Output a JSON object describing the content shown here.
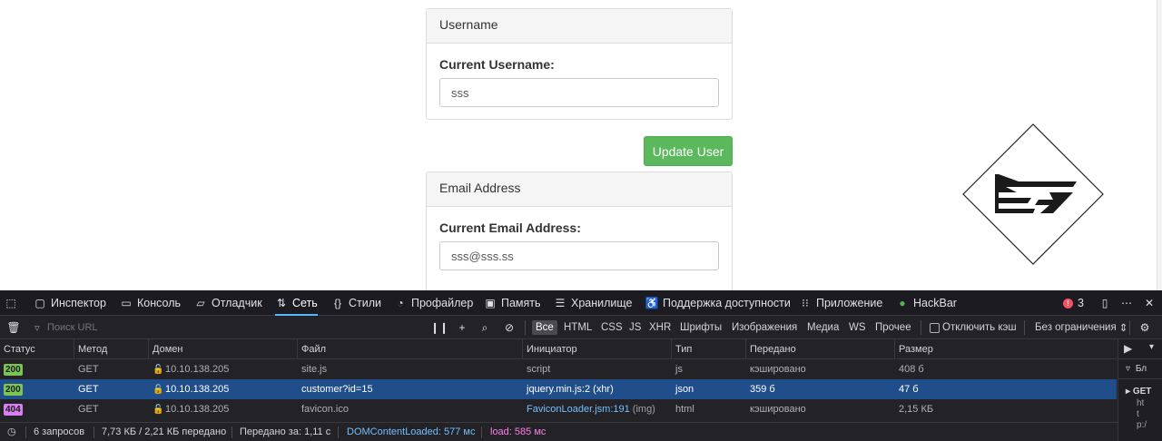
{
  "page": {
    "username_panel": {
      "heading": "Username",
      "label": "Current Username:",
      "value": "sss"
    },
    "update_button": "Update User",
    "email_panel": {
      "heading": "Email Address",
      "label": "Current Email Address:",
      "value": "sss@sss.ss"
    },
    "logo_icon": "diamond-logo-icon"
  },
  "devtools": {
    "tabs": [
      {
        "label": "Инспектор",
        "icon": "inspector-icon"
      },
      {
        "label": "Консоль",
        "icon": "console-icon"
      },
      {
        "label": "Отладчик",
        "icon": "debugger-icon"
      },
      {
        "label": "Сеть",
        "icon": "network-icon"
      },
      {
        "label": "Стили",
        "icon": "styles-icon"
      },
      {
        "label": "Профайлер",
        "icon": "profiler-icon"
      },
      {
        "label": "Память",
        "icon": "memory-icon"
      },
      {
        "label": "Хранилище",
        "icon": "storage-icon"
      },
      {
        "label": "Поддержка доступности",
        "icon": "accessibility-icon"
      },
      {
        "label": "Приложение",
        "icon": "application-icon"
      },
      {
        "label": "HackBar",
        "icon": "hackbar-icon"
      }
    ],
    "active_tab": "Сеть",
    "error_count": "3",
    "filter_placeholder": "Поиск URL",
    "type_filters": [
      "Все",
      "HTML",
      "CSS",
      "JS",
      "XHR",
      "Шрифты",
      "Изображения",
      "Медиа",
      "WS",
      "Прочее"
    ],
    "active_type_filter": "Все",
    "disable_cache_label": "Отключить кэш",
    "throttling": "Без ограничения",
    "columns": [
      "Статус",
      "Метод",
      "Домен",
      "Файл",
      "Инициатор",
      "Тип",
      "Передано",
      "Размер"
    ],
    "requests": [
      {
        "status": "200",
        "method": "GET",
        "domain": "10.10.138.205",
        "file": "site.js",
        "initiator": "script",
        "initiator_extra": "",
        "type": "js",
        "transferred": "кэшировано",
        "size": "408 б",
        "selected": false
      },
      {
        "status": "200",
        "method": "GET",
        "domain": "10.10.138.205",
        "file": "customer?id=15",
        "initiator": "jquery.min.js:2 (xhr)",
        "initiator_extra": "",
        "type": "json",
        "transferred": "359 б",
        "size": "47 б",
        "selected": true
      },
      {
        "status": "404",
        "method": "GET",
        "domain": "10.10.138.205",
        "file": "favicon.ico",
        "initiator": "FaviconLoader.jsm:191",
        "initiator_extra": "(img)",
        "type": "html",
        "transferred": "кэшировано",
        "size": "2,15 КБ",
        "selected": false
      }
    ],
    "status_colors": {
      "200": "#7ac554",
      "404": "#d97ff3"
    },
    "summary": {
      "requests": "6 запросов",
      "transferred": "7,73 КБ / 2,21 КБ передано",
      "finish": "Передано за: 1,11 с",
      "dom_loaded": "DOMContentLoaded: 577 мс",
      "load": "load: 585 мс"
    },
    "sidebar": {
      "filter_text": "Бл",
      "request_label": "GET",
      "lines": [
        "ht",
        "t",
        "p:/"
      ]
    }
  }
}
